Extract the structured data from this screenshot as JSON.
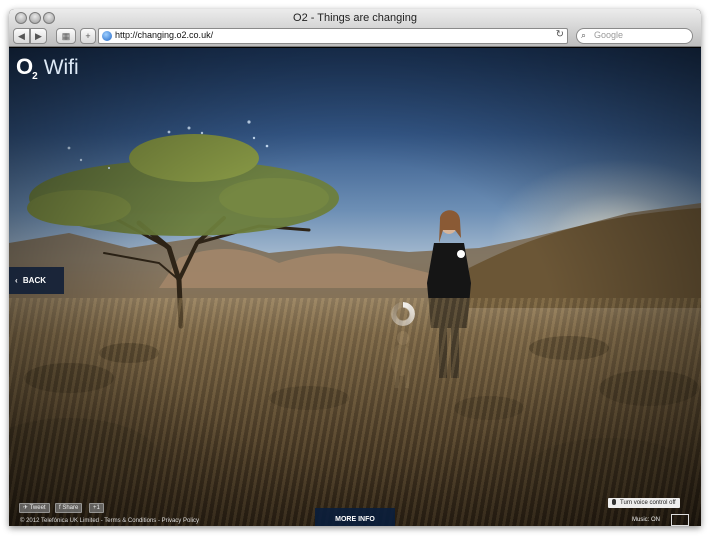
{
  "browser": {
    "title": "O2 - Things are changing",
    "url": "http://changing.o2.co.uk/",
    "search_placeholder": "Google"
  },
  "header": {
    "logo_o2": "O",
    "logo_sub": "2",
    "logo_wifi": "Wifi"
  },
  "nav": {
    "back_label": "BACK"
  },
  "footer": {
    "tweet_label": "Tweet",
    "share_label": "Share",
    "plus_label": "+1",
    "copyright": "© 2012 Telefónica UK Limited",
    "terms_label": "Terms & Conditions",
    "privacy_label": "Privacy Policy",
    "separator": " - ",
    "more_info_label": "MORE INFO",
    "voice_control_label": "Turn voice control off",
    "music_label": "Music: ON"
  },
  "colors": {
    "accent_dark_blue": "#0f1e37",
    "sky": "#35598a"
  }
}
